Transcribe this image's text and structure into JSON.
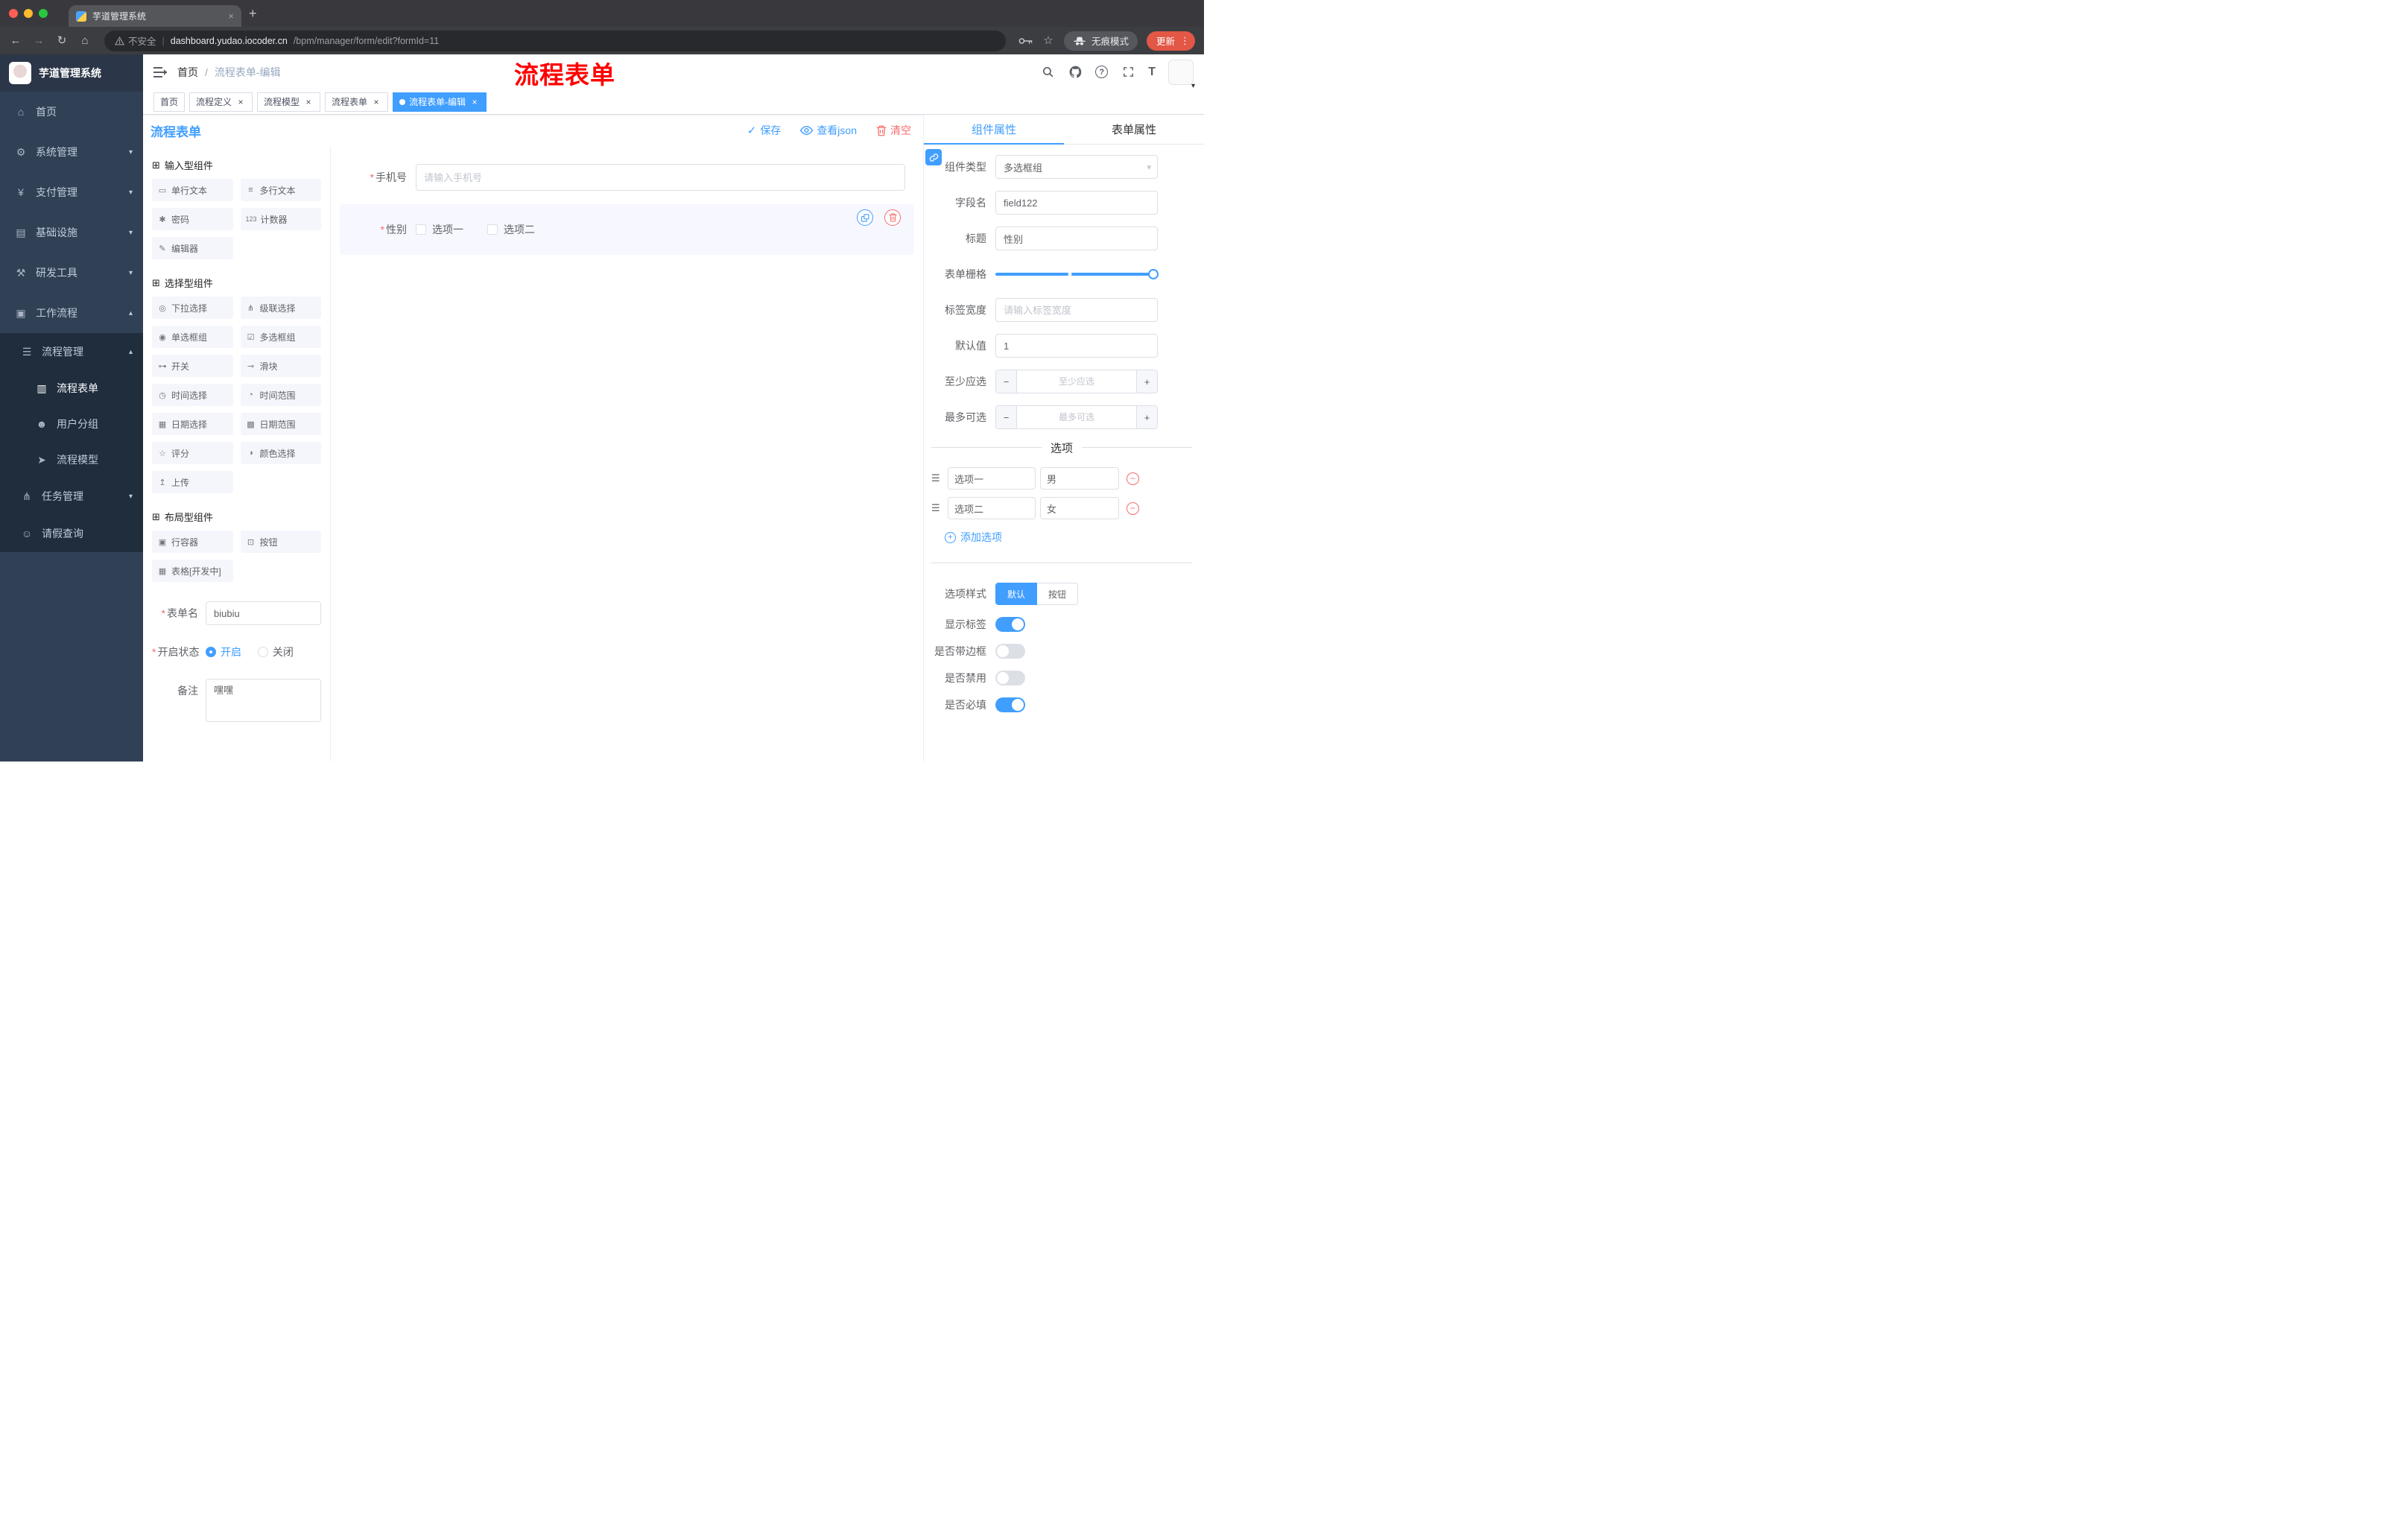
{
  "browser": {
    "tab_title": "芋道管理系统",
    "security_label": "不安全",
    "url_domain": "dashboard.yudao.iocoder.cn",
    "url_path": "/bpm/manager/form/edit?formId=11",
    "incognito_label": "无痕模式",
    "update_label": "更新"
  },
  "sidebar": {
    "logo_title": "芋道管理系统",
    "items": [
      {
        "label": "首页"
      },
      {
        "label": "系统管理"
      },
      {
        "label": "支付管理"
      },
      {
        "label": "基础设施"
      },
      {
        "label": "研发工具"
      },
      {
        "label": "工作流程"
      },
      {
        "label": "流程管理"
      },
      {
        "label": "流程表单"
      },
      {
        "label": "用户分组"
      },
      {
        "label": "流程模型"
      },
      {
        "label": "任务管理"
      },
      {
        "label": "请假查询"
      }
    ]
  },
  "header": {
    "breadcrumb_home": "首页",
    "breadcrumb_current": "流程表单-编辑",
    "annotation": "流程表单"
  },
  "tags": [
    {
      "label": "首页"
    },
    {
      "label": "流程定义"
    },
    {
      "label": "流程模型"
    },
    {
      "label": "流程表单"
    },
    {
      "label": "流程表单-编辑"
    }
  ],
  "workspace": {
    "title": "流程表单"
  },
  "toolbar": {
    "save": "保存",
    "view_json": "查看json",
    "clear": "清空"
  },
  "palette": {
    "sections": [
      {
        "title": "输入型组件",
        "items": [
          {
            "icon": "▭",
            "label": "单行文本"
          },
          {
            "icon": "≡",
            "label": "多行文本"
          },
          {
            "icon": "✱",
            "label": "密码"
          },
          {
            "icon": "123",
            "label": "计数器"
          },
          {
            "icon": "✎",
            "label": "编辑器"
          }
        ]
      },
      {
        "title": "选择型组件",
        "items": [
          {
            "icon": "◎",
            "label": "下拉选择"
          },
          {
            "icon": "⋔",
            "label": "级联选择"
          },
          {
            "icon": "◉",
            "label": "单选框组"
          },
          {
            "icon": "☑",
            "label": "多选框组"
          },
          {
            "icon": "⊶",
            "label": "开关"
          },
          {
            "icon": "⊸",
            "label": "滑块"
          },
          {
            "icon": "◷",
            "label": "时间选择"
          },
          {
            "icon": "◔",
            "label": "时间范围"
          },
          {
            "icon": "▦",
            "label": "日期选择"
          },
          {
            "icon": "▩",
            "label": "日期范围"
          },
          {
            "icon": "☆",
            "label": "评分"
          },
          {
            "icon": "◑",
            "label": "颜色选择"
          },
          {
            "icon": "↥",
            "label": "上传"
          }
        ]
      },
      {
        "title": "布局型组件",
        "items": [
          {
            "icon": "▣",
            "label": "行容器"
          },
          {
            "icon": "⊡",
            "label": "按钮"
          },
          {
            "icon": "▦",
            "label": "表格[开发中]"
          }
        ]
      }
    ],
    "form": {
      "name_label": "表单名",
      "name_value": "biubiu",
      "status_label": "开启状态",
      "status_on": "开启",
      "status_off": "关闭",
      "remark_label": "备注",
      "remark_value": "嘿嘿"
    }
  },
  "canvas": {
    "phone_label": "手机号",
    "phone_placeholder": "请输入手机号",
    "gender_label": "性别",
    "gender_option1": "选项一",
    "gender_option2": "选项二"
  },
  "properties": {
    "tab_component": "组件属性",
    "tab_form": "表单属性",
    "component_type_label": "组件类型",
    "component_type_value": "多选框组",
    "field_name_label": "字段名",
    "field_name_value": "field122",
    "title_label": "标题",
    "title_value": "性别",
    "grid_label": "表单栅格",
    "tag_width_label": "标签宽度",
    "tag_width_placeholder": "请输入标签宽度",
    "default_label": "默认值",
    "default_value": "1",
    "min_label": "至少应选",
    "min_placeholder": "至少应选",
    "max_label": "最多可选",
    "max_placeholder": "最多可选",
    "options_title": "选项",
    "options": [
      {
        "label": "选项一",
        "value": "男"
      },
      {
        "label": "选项二",
        "value": "女"
      }
    ],
    "add_option": "添加选项",
    "style_label": "选项样式",
    "style_default": "默认",
    "style_button": "按钮",
    "switch_show_label": "显示标签",
    "switch_border": "是否带边框",
    "switch_disabled": "是否禁用",
    "switch_required": "是否必填",
    "switch_states": {
      "show_label": true,
      "border": false,
      "disabled": false,
      "required": true
    }
  },
  "icons": {
    "close": "×",
    "plus": "+",
    "minus": "−",
    "back": "←",
    "forward": "→",
    "reload": "↻",
    "home_nav": "⌂",
    "bookmark": "☆",
    "menu_dots": "⋮",
    "menu_home": "⌂",
    "menu_system": "⚙",
    "menu_payment": "¥",
    "menu_infra": "▤",
    "menu_devtools": "⚒",
    "menu_workflow": "▣",
    "menu_process": "☰",
    "menu_form": "▥",
    "menu_usergroup": "☻",
    "menu_model": "➤",
    "menu_task": "⋔",
    "menu_leave": "☺",
    "arrow_down": "▾",
    "arrow_up": "▴",
    "section": "⊞",
    "check": "✓",
    "question": "?",
    "size": "T",
    "select_caret": "▾",
    "drag": "☰",
    "required_mark": "*"
  },
  "colors": {
    "accent": "#409eff",
    "danger": "#f56c6c",
    "annotation": "#fe0000",
    "sidebar_bg": "#304156",
    "submenu_bg": "#1f2d3d",
    "active_tag": "#409eff"
  }
}
